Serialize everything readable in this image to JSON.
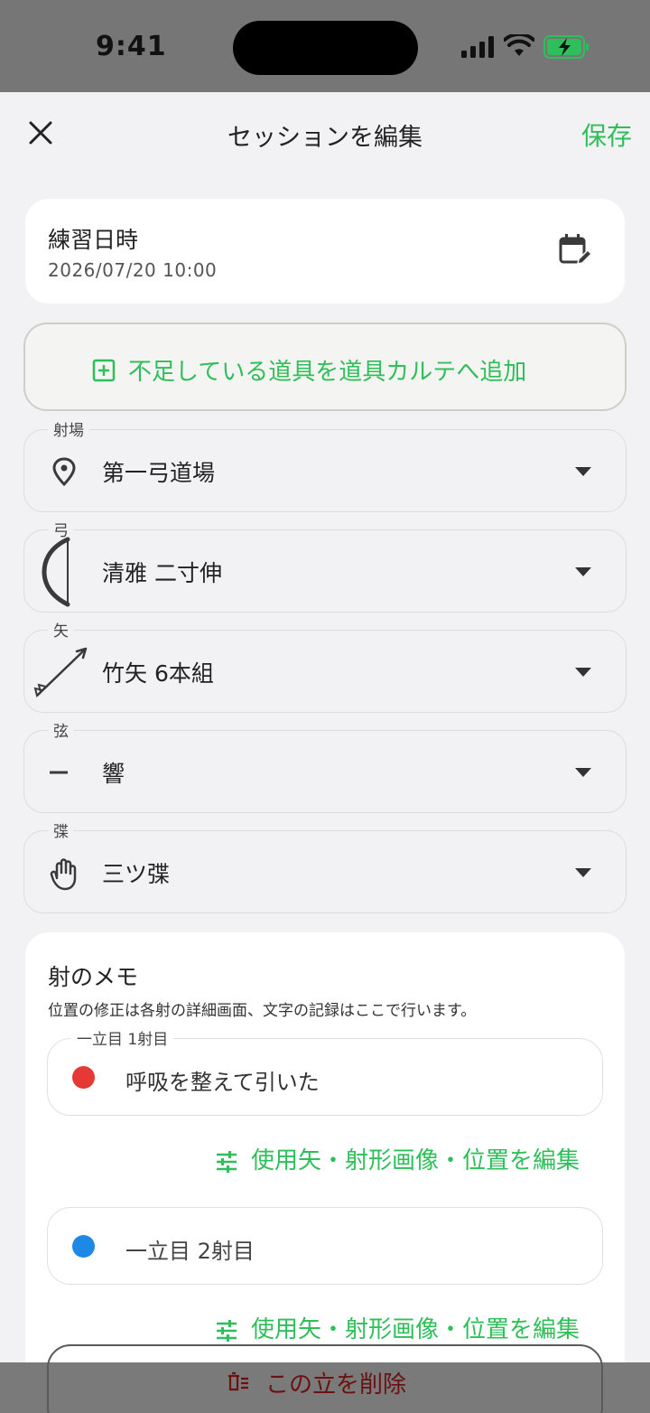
{
  "status": {
    "time": "9:41"
  },
  "nav": {
    "title": "セッションを編集",
    "save_label": "保存"
  },
  "date_card": {
    "label": "練習日時",
    "value": "2026/07/20 10:00"
  },
  "add_equipment": {
    "label": "不足している道具を道具カルテへ追加"
  },
  "fields": {
    "range": {
      "label": "射場",
      "value": "第一弓道場",
      "icon": "location-pin-icon"
    },
    "bow": {
      "label": "弓",
      "value": "清雅 二寸伸",
      "icon": "bow-icon"
    },
    "arrow": {
      "label": "矢",
      "value": "竹矢 6本組",
      "icon": "arrow-icon"
    },
    "string": {
      "label": "弦",
      "value": "響",
      "icon": "dash-icon"
    },
    "glove": {
      "label": "弽",
      "value": "三ツ弽",
      "icon": "hand-icon"
    }
  },
  "memo": {
    "title": "射のメモ",
    "description": "位置の修正は各射の詳細画面、文字の記録はここで行います。",
    "shots": [
      {
        "label": "一立目 1射目",
        "text": "呼吸を整えて引いた",
        "dot_color": "#e53935"
      },
      {
        "label": "",
        "text": "一立目 2射目",
        "dot_color": "#1e88e5"
      }
    ],
    "edit_label": "使用矢・射形画像・位置を編集"
  },
  "delete": {
    "label": "この立を削除"
  },
  "colors": {
    "accent": "#2fbf5a",
    "danger": "#6a1212"
  }
}
